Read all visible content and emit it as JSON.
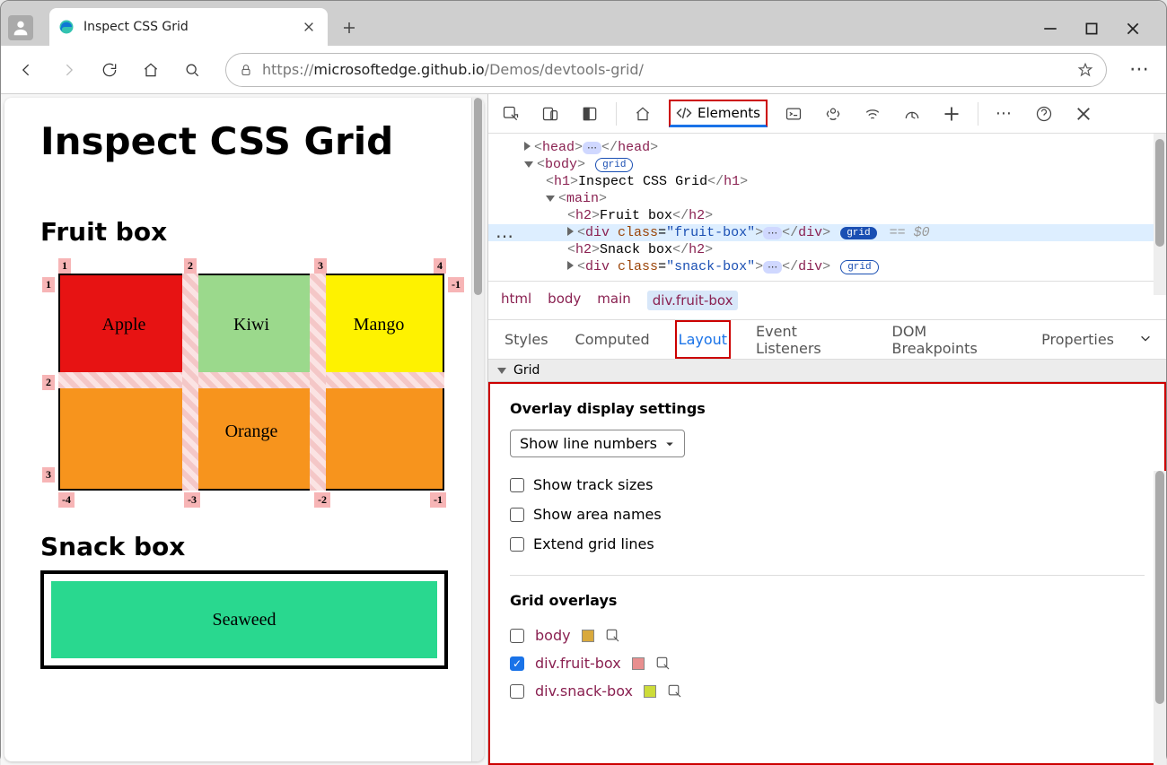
{
  "tab": {
    "title": "Inspect CSS Grid"
  },
  "url": {
    "scheme": "https://",
    "host": "microsoftedge.github.io",
    "path": "/Demos/devtools-grid/"
  },
  "page": {
    "h1": "Inspect CSS Grid",
    "h2_fruit": "Fruit box",
    "h2_snack": "Snack box",
    "cells": {
      "apple": "Apple",
      "kiwi": "Kiwi",
      "mango": "Mango",
      "orange": "Orange",
      "seaweed": "Seaweed"
    },
    "grid_labels": {
      "top": [
        "1",
        "2",
        "3",
        "4"
      ],
      "left": [
        "1",
        "2",
        "3"
      ],
      "right_neg": "-1",
      "bottom_neg": [
        "-4",
        "-3",
        "-2",
        "-1"
      ]
    }
  },
  "devtools": {
    "tabs": {
      "elements": "Elements"
    },
    "dom": {
      "head": "head",
      "body": "body",
      "grid_pill": "grid",
      "h1_text": "Inspect CSS Grid",
      "main": "main",
      "h2_fruit": "Fruit box",
      "fruit_div_class_attr": "class",
      "fruit_div_class_val": "\"fruit-box\"",
      "h2_snack": "Snack box",
      "snack_div_class_val": "\"snack-box\"",
      "console_ref": "== $0"
    },
    "breadcrumb": [
      "html",
      "body",
      "main",
      "div.fruit-box"
    ],
    "subtabs": [
      "Styles",
      "Computed",
      "Layout",
      "Event Listeners",
      "DOM Breakpoints",
      "Properties"
    ],
    "layout": {
      "section_title": "Grid",
      "overlay_heading": "Overlay display settings",
      "select_label": "Show line numbers",
      "checks": [
        "Show track sizes",
        "Show area names",
        "Extend grid lines"
      ],
      "overlays_heading": "Grid overlays",
      "overlays": [
        {
          "name": "body",
          "color": "#d9a93c",
          "checked": false
        },
        {
          "name": "div.fruit-box",
          "color": "#e88f8f",
          "checked": true
        },
        {
          "name": "div.snack-box",
          "color": "#cddc39",
          "checked": false
        }
      ]
    }
  }
}
